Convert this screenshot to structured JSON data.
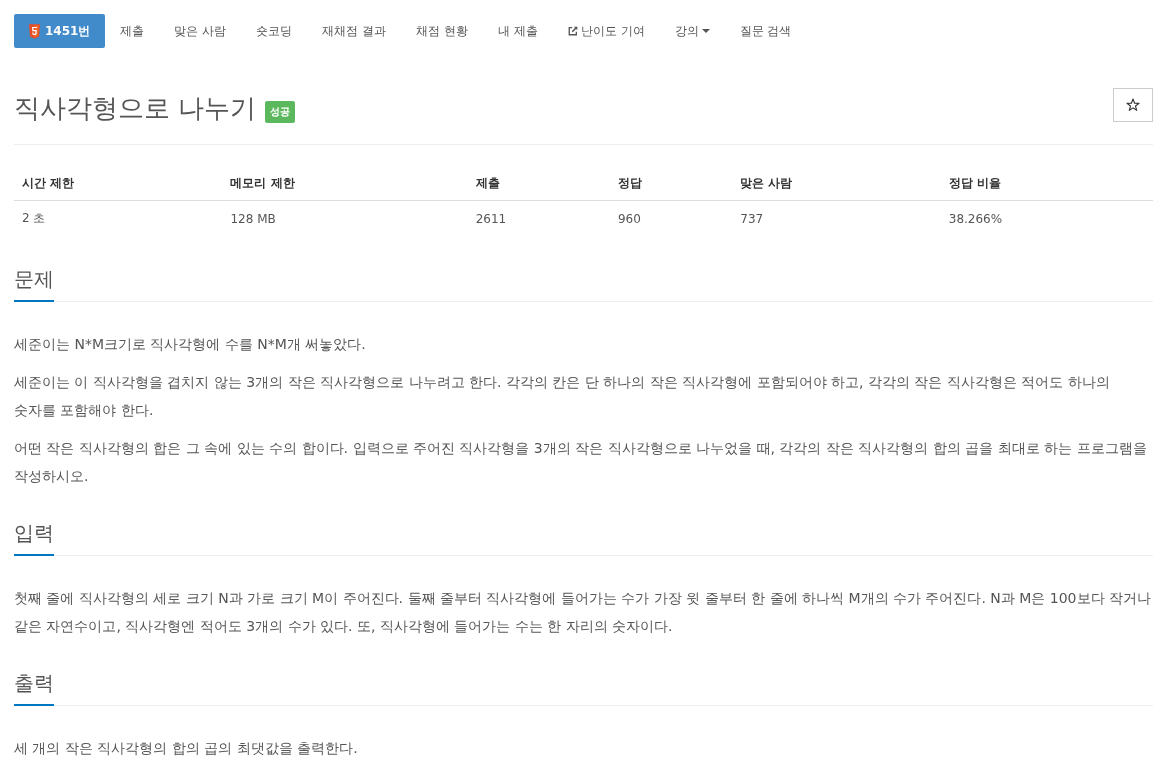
{
  "nav": {
    "tabs": [
      {
        "label": "1451번",
        "selected": true,
        "kind": "problem"
      },
      {
        "label": "제출",
        "selected": false,
        "kind": "plain"
      },
      {
        "label": "맞은 사람",
        "selected": false,
        "kind": "plain"
      },
      {
        "label": "숏코딩",
        "selected": false,
        "kind": "plain"
      },
      {
        "label": "재채점 결과",
        "selected": false,
        "kind": "plain"
      },
      {
        "label": "채점 현황",
        "selected": false,
        "kind": "plain"
      },
      {
        "label": "내 제출",
        "selected": false,
        "kind": "plain"
      },
      {
        "label": "난이도 기여",
        "selected": false,
        "kind": "external"
      },
      {
        "label": "강의",
        "selected": false,
        "kind": "dropdown"
      },
      {
        "label": "질문 검색",
        "selected": false,
        "kind": "plain"
      }
    ]
  },
  "problem": {
    "title": "직사각형으로 나누기",
    "badge": "성공",
    "starred": false
  },
  "table": {
    "columns": [
      "시간 제한",
      "메모리 제한",
      "제출",
      "정답",
      "맞은 사람",
      "정답 비율"
    ],
    "rows": [
      [
        "2 초",
        "128 MB",
        "2611",
        "960",
        "737",
        "38.266%"
      ]
    ]
  },
  "sections": [
    {
      "heading": "문제",
      "paragraphs": [
        "세준이는 N*M크기로 직사각형에 수를 N*M개 써놓았다.",
        "세준이는 이 직사각형을 겹치지 않는 3개의 작은 직사각형으로 나누려고 한다. 각각의 칸은 단 하나의 작은 직사각형에 포함되어야 하고, 각각의 작은 직사각형은 적어도 하나의 숫자를 포함해야 한다.",
        "어떤 작은 직사각형의 합은 그 속에 있는 수의 합이다. 입력으로 주어진 직사각형을 3개의 작은 직사각형으로 나누었을 때, 각각의 작은 직사각형의 합의 곱을 최대로 하는 프로그램을 작성하시오."
      ]
    },
    {
      "heading": "입력",
      "paragraphs": [
        "첫째 줄에 직사각형의 세로 크기 N과 가로 크기 M이 주어진다. 둘째 줄부터 직사각형에 들어가는 수가 가장 윗 줄부터 한 줄에 하나씩 M개의 수가 주어진다. N과 M은 100보다 작거나 같은 자연수이고, 직사각형엔 적어도 3개의 수가 있다. 또, 직사각형에 들어가는 수는 한 자리의 숫자이다."
      ]
    },
    {
      "heading": "출력",
      "paragraphs": [
        "세 개의 작은 직사각형의 합의 곱의 최댓값을 출력한다."
      ]
    }
  ]
}
